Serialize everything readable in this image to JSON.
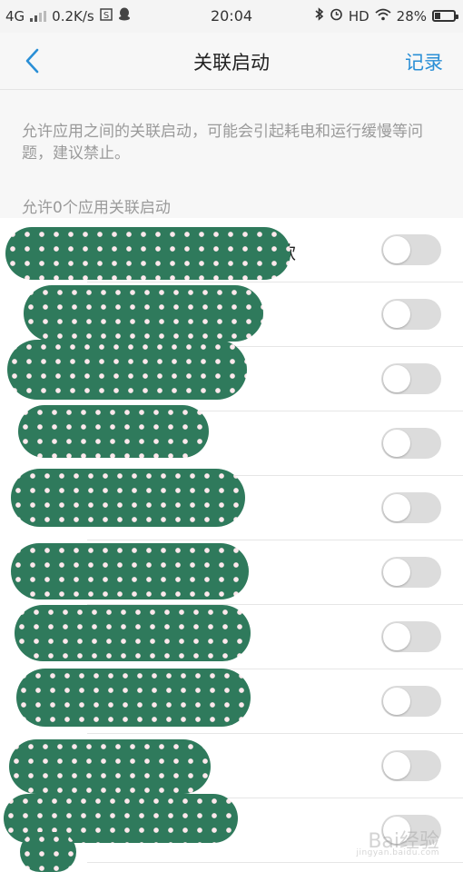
{
  "status_bar": {
    "network": "4G",
    "speed": "0.2K/s",
    "time": "20:04",
    "hd": "HD",
    "battery_percent": "28%",
    "battery_level": 0.28,
    "icons": [
      "signal-icon",
      "notification-s-icon",
      "qq-icon",
      "bluetooth-icon",
      "alarm-icon",
      "wifi-icon",
      "battery-icon"
    ]
  },
  "header": {
    "back_icon": "chevron-left-icon",
    "title": "关联启动",
    "record_label": "记录",
    "accent": "#2a8fd6"
  },
  "description": "允许应用之间的关联启动，可能会引起耗电和运行缓慢等问题，建议禁止。",
  "section_label": "允许0个应用关联启动",
  "apps": [
    {
      "name": "款",
      "enabled": false
    },
    {
      "name": "",
      "enabled": false
    },
    {
      "name": "",
      "enabled": false
    },
    {
      "name": "",
      "enabled": false
    },
    {
      "name": "",
      "enabled": false
    },
    {
      "name": "",
      "enabled": false
    },
    {
      "name": "",
      "enabled": false
    },
    {
      "name": "",
      "enabled": false
    },
    {
      "name": "",
      "enabled": false
    },
    {
      "name": "",
      "enabled": false
    }
  ],
  "watermark": {
    "text": "Bai经验",
    "subtext": "jingyan.baidu.com"
  }
}
